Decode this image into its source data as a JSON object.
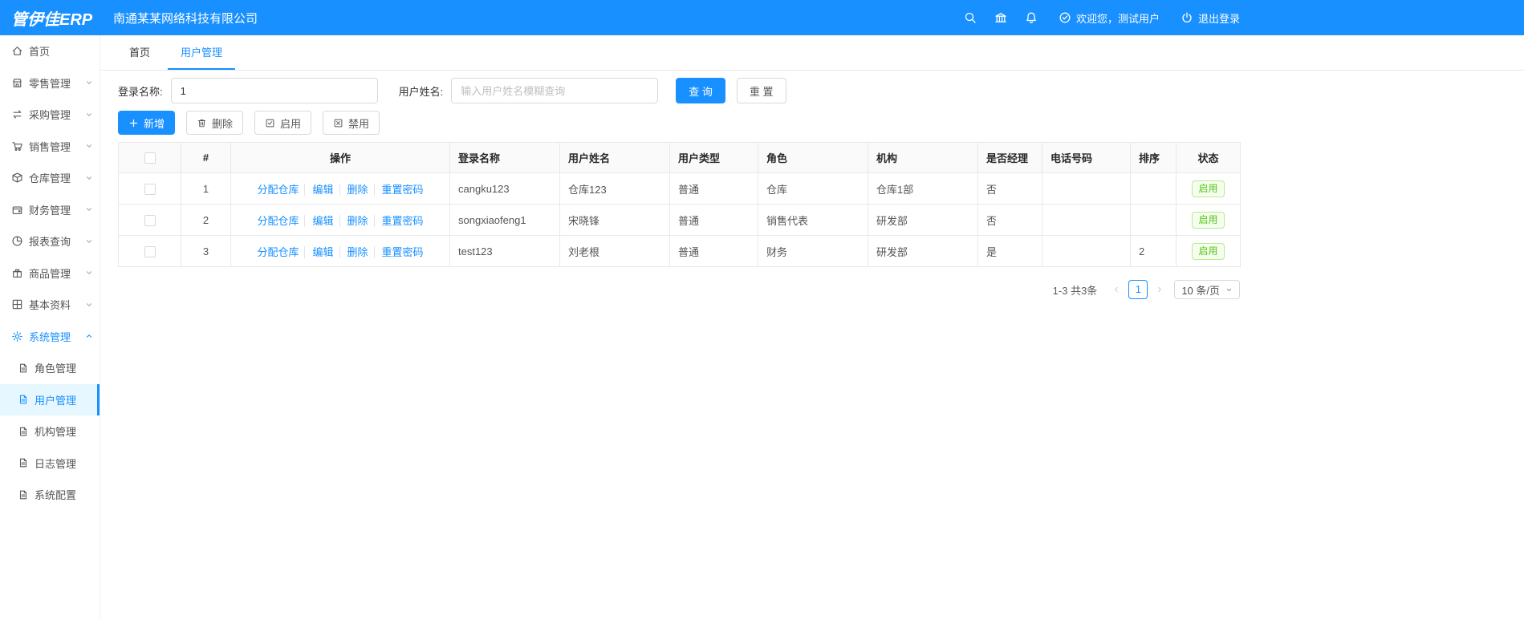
{
  "topbar": {
    "logo": "管伊佳ERP",
    "company": "南通某某网络科技有限公司",
    "welcome": "欢迎您，测试用户",
    "logout": "退出登录"
  },
  "sidebar": {
    "items": [
      {
        "label": "首页"
      },
      {
        "label": "零售管理"
      },
      {
        "label": "采购管理"
      },
      {
        "label": "销售管理"
      },
      {
        "label": "仓库管理"
      },
      {
        "label": "财务管理"
      },
      {
        "label": "报表查询"
      },
      {
        "label": "商品管理"
      },
      {
        "label": "基本资料"
      },
      {
        "label": "系统管理"
      }
    ],
    "system_submenu": [
      {
        "label": "角色管理"
      },
      {
        "label": "用户管理"
      },
      {
        "label": "机构管理"
      },
      {
        "label": "日志管理"
      },
      {
        "label": "系统配置"
      }
    ]
  },
  "tabs": {
    "home": "首页",
    "current": "用户管理"
  },
  "filters": {
    "login_label": "登录名称:",
    "login_value": "1",
    "name_label": "用户姓名:",
    "name_placeholder": "输入用户姓名模糊查询",
    "search": "查 询",
    "reset": "重 置"
  },
  "toolbar": {
    "add": "新增",
    "delete": "删除",
    "enable": "启用",
    "disable": "禁用"
  },
  "table": {
    "headers": {
      "index": "#",
      "actions": "操作",
      "login": "登录名称",
      "name": "用户姓名",
      "type": "用户类型",
      "role": "角色",
      "org": "机构",
      "manager": "是否经理",
      "phone": "电话号码",
      "sort": "排序",
      "status": "状态"
    },
    "actions": {
      "assign": "分配仓库",
      "edit": "编辑",
      "del": "删除",
      "reset_pwd": "重置密码"
    },
    "rows": [
      {
        "index": "1",
        "login": "cangku123",
        "name": "仓库123",
        "type": "普通",
        "role": "仓库",
        "org": "仓库1部",
        "manager": "否",
        "phone": "",
        "sort": "",
        "status": "启用"
      },
      {
        "index": "2",
        "login": "songxiaofeng1",
        "name": "宋晓锋",
        "type": "普通",
        "role": "销售代表",
        "org": "研发部",
        "manager": "否",
        "phone": "",
        "sort": "",
        "status": "启用"
      },
      {
        "index": "3",
        "login": "test123",
        "name": "刘老根",
        "type": "普通",
        "role": "财务",
        "org": "研发部",
        "manager": "是",
        "phone": "",
        "sort": "2",
        "status": "启用"
      }
    ]
  },
  "pagination": {
    "total": "1-3 共3条",
    "current_page": "1",
    "page_size": "10 条/页"
  }
}
